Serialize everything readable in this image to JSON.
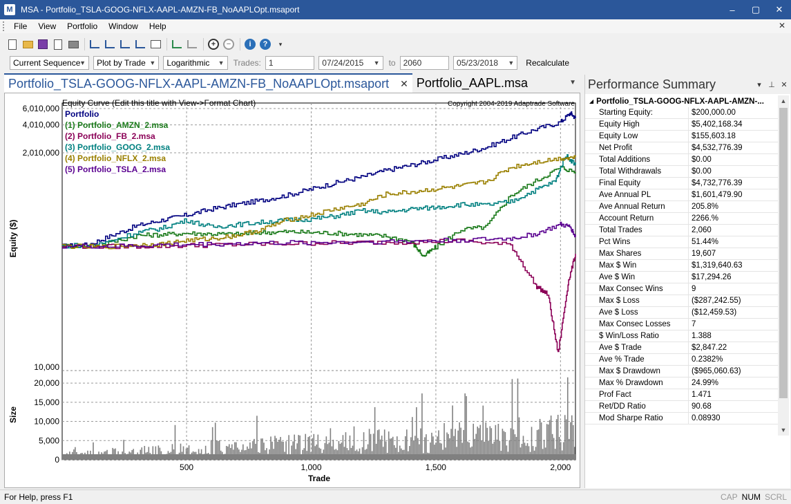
{
  "window": {
    "logo": "M",
    "title": "MSA - Portfolio_TSLA-GOOG-NFLX-AAPL-AMZN-FB_NoAAPLOpt.msaport",
    "minimize": "–",
    "maximize": "▢",
    "close": "✕"
  },
  "menu": {
    "items": [
      "File",
      "View",
      "Portfolio",
      "Window",
      "Help"
    ],
    "close_glyph": "✕"
  },
  "toolbar2": {
    "sequence": "Current Sequence",
    "plot_by": "Plot by Trade",
    "scale": "Logarithmic",
    "trades_label": "Trades:",
    "trades_from": "1",
    "date_from": "07/24/2015",
    "to_label": "to",
    "trades_to": "2060",
    "date_to": "05/23/2018",
    "recalc": "Recalculate"
  },
  "tabs": [
    {
      "label": "Portfolio_TSLA-GOOG-NFLX-AAPL-AMZN-FB_NoAAPLOpt.msaport",
      "active": true
    },
    {
      "label": "Portfolio_AAPL.msa",
      "active": false
    }
  ],
  "chart_data": {
    "type": "line",
    "title": "Equity Curve (Edit this title with View->Format Chart)",
    "copyright": "Copyright 2004-2019 Adaptrade Software",
    "ylabel": "Equity ($)",
    "xlabel": "Trade",
    "yscale": "log",
    "ylim": [
      10000,
      6010000
    ],
    "y_ticks": [
      "6,010,000",
      "4,010,000",
      "2,010,000",
      "10,000"
    ],
    "xlim": [
      1,
      2060
    ],
    "x_ticks": [
      500,
      1000,
      1500,
      2000
    ],
    "x_tick_labels": [
      "500",
      "1,000",
      "1,500",
      "2,000"
    ],
    "legend_placement": "top-left",
    "series": [
      {
        "name": "Portfolio",
        "color": "#000080",
        "points": [
          [
            1,
            200000
          ],
          [
            100,
            205000
          ],
          [
            200,
            260000
          ],
          [
            300,
            330000
          ],
          [
            400,
            380000
          ],
          [
            500,
            430000
          ],
          [
            600,
            500000
          ],
          [
            700,
            560000
          ],
          [
            800,
            620000
          ],
          [
            900,
            700000
          ],
          [
            1000,
            820000
          ],
          [
            1100,
            960000
          ],
          [
            1200,
            1100000
          ],
          [
            1300,
            1300000
          ],
          [
            1400,
            1480000
          ],
          [
            1500,
            1700000
          ],
          [
            1600,
            1950000
          ],
          [
            1700,
            2300000
          ],
          [
            1800,
            2900000
          ],
          [
            1900,
            3600000
          ],
          [
            2000,
            4300000
          ],
          [
            2040,
            5400000
          ],
          [
            2060,
            4730000
          ]
        ]
      },
      {
        "name": "(1) Portfolio_AMZN_2.msa",
        "color": "#1a7a1a",
        "points": [
          [
            1,
            200000
          ],
          [
            150,
            205000
          ],
          [
            300,
            260000
          ],
          [
            400,
            265000
          ],
          [
            500,
            275000
          ],
          [
            600,
            270000
          ],
          [
            700,
            268000
          ],
          [
            800,
            280000
          ],
          [
            900,
            285000
          ],
          [
            1000,
            280000
          ],
          [
            1100,
            275000
          ],
          [
            1200,
            265000
          ],
          [
            1300,
            255000
          ],
          [
            1400,
            225000
          ],
          [
            1450,
            155000
          ],
          [
            1500,
            195000
          ],
          [
            1600,
            300000
          ],
          [
            1700,
            320000
          ],
          [
            1800,
            700000
          ],
          [
            1900,
            1000000
          ],
          [
            2000,
            1400000
          ],
          [
            2060,
            1250000
          ]
        ]
      },
      {
        "name": "(2) Portfolio_FB_2.msa",
        "color": "#8b0057",
        "points": [
          [
            1,
            200000
          ],
          [
            200,
            198000
          ],
          [
            400,
            200000
          ],
          [
            600,
            205000
          ],
          [
            800,
            210000
          ],
          [
            1000,
            215000
          ],
          [
            1200,
            218000
          ],
          [
            1400,
            222000
          ],
          [
            1600,
            228000
          ],
          [
            1800,
            205000
          ],
          [
            1900,
            75000
          ],
          [
            1950,
            60000
          ],
          [
            1990,
            14000
          ],
          [
            2030,
            80000
          ],
          [
            2060,
            165000
          ]
        ]
      },
      {
        "name": "(3) Portfolio_GOOG_2.msa",
        "color": "#008080",
        "points": [
          [
            1,
            200000
          ],
          [
            150,
            210000
          ],
          [
            300,
            280000
          ],
          [
            400,
            310000
          ],
          [
            500,
            380000
          ],
          [
            600,
            320000
          ],
          [
            700,
            340000
          ],
          [
            800,
            360000
          ],
          [
            900,
            380000
          ],
          [
            1000,
            390000
          ],
          [
            1100,
            420000
          ],
          [
            1200,
            480000
          ],
          [
            1300,
            460000
          ],
          [
            1400,
            500000
          ],
          [
            1500,
            520000
          ],
          [
            1600,
            560000
          ],
          [
            1700,
            550000
          ],
          [
            1800,
            600000
          ],
          [
            1900,
            800000
          ],
          [
            1980,
            1000000
          ],
          [
            2020,
            1900000
          ],
          [
            2060,
            1500000
          ]
        ]
      },
      {
        "name": "(4) Portfolio_NFLX_2.msa",
        "color": "#9a8000",
        "points": [
          [
            1,
            200000
          ],
          [
            150,
            195000
          ],
          [
            300,
            205000
          ],
          [
            400,
            210000
          ],
          [
            500,
            230000
          ],
          [
            600,
            240000
          ],
          [
            700,
            260000
          ],
          [
            800,
            300000
          ],
          [
            900,
            380000
          ],
          [
            1000,
            430000
          ],
          [
            1100,
            500000
          ],
          [
            1200,
            560000
          ],
          [
            1300,
            720000
          ],
          [
            1400,
            760000
          ],
          [
            1500,
            820000
          ],
          [
            1600,
            880000
          ],
          [
            1700,
            980000
          ],
          [
            1800,
            1400000
          ],
          [
            1900,
            1600000
          ],
          [
            2000,
            1750000
          ],
          [
            2060,
            1800000
          ]
        ]
      },
      {
        "name": "(5) Portfolio_TSLA_2.msa",
        "color": "#5a0090",
        "points": [
          [
            1,
            200000
          ],
          [
            200,
            198000
          ],
          [
            400,
            205000
          ],
          [
            600,
            210000
          ],
          [
            800,
            215000
          ],
          [
            1000,
            218000
          ],
          [
            1200,
            222000
          ],
          [
            1400,
            226000
          ],
          [
            1600,
            232000
          ],
          [
            1800,
            240000
          ],
          [
            1900,
            270000
          ],
          [
            2000,
            340000
          ],
          [
            2040,
            320000
          ],
          [
            2060,
            250000
          ]
        ]
      }
    ],
    "size_panel": {
      "ylabel": "Size",
      "ylim": [
        0,
        22000
      ],
      "y_ticks": [
        "20,000",
        "15,000",
        "10,000",
        "5,000",
        "0"
      ],
      "color": "#808080"
    }
  },
  "panel": {
    "title": "Performance Summary",
    "menu_glyph": "▾",
    "pin_glyph": "⊥",
    "close_glyph": "✕",
    "group": "Portfolio_TSLA-GOOG-NFLX-AAPL-AMZN-...",
    "group_glyph": "◢",
    "rows": [
      {
        "name": "Starting Equity:",
        "value": "$200,000.00"
      },
      {
        "name": "Equity High",
        "value": "$5,402,168.34"
      },
      {
        "name": "Equity Low",
        "value": "$155,603.18"
      },
      {
        "name": "Net Profit",
        "value": "$4,532,776.39"
      },
      {
        "name": "Total Additions",
        "value": "$0.00"
      },
      {
        "name": "Total Withdrawals",
        "value": "$0.00"
      },
      {
        "name": "Final Equity",
        "value": "$4,732,776.39"
      },
      {
        "name": "Ave Annual PL",
        "value": "$1,601,479.90"
      },
      {
        "name": "Ave Annual Return",
        "value": "205.8%"
      },
      {
        "name": "Account Return",
        "value": "2266.%"
      },
      {
        "name": "Total Trades",
        "value": "2,060"
      },
      {
        "name": "Pct Wins",
        "value": "51.44%"
      },
      {
        "name": "Max Shares",
        "value": "19,607"
      },
      {
        "name": "Max $ Win",
        "value": "$1,319,640.63"
      },
      {
        "name": "Ave $ Win",
        "value": "$17,294.26"
      },
      {
        "name": "Max Consec Wins",
        "value": "9"
      },
      {
        "name": "Max $ Loss",
        "value": "($287,242.55)"
      },
      {
        "name": "Ave $ Loss",
        "value": "($12,459.53)"
      },
      {
        "name": "Max Consec Losses",
        "value": "7"
      },
      {
        "name": "$ Win/Loss Ratio",
        "value": "1.388"
      },
      {
        "name": "Ave $ Trade",
        "value": "$2,847.22"
      },
      {
        "name": "Ave % Trade",
        "value": "0.2382%"
      },
      {
        "name": "Max $ Drawdown",
        "value": "($965,060.63)"
      },
      {
        "name": "Max % Drawdown",
        "value": "24.99%"
      },
      {
        "name": "Prof Fact",
        "value": "1.471"
      },
      {
        "name": "Ret/DD Ratio",
        "value": "90.68"
      },
      {
        "name": "Mod Sharpe Ratio",
        "value": "0.08930"
      }
    ]
  },
  "status": {
    "text": "For Help, press F1",
    "cap": "CAP",
    "num": "NUM",
    "scrl": "SCRL"
  }
}
